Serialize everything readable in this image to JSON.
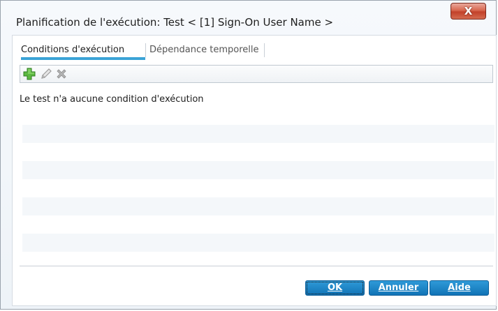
{
  "window": {
    "title": "Planification de l'exécution: Test < [1] Sign-On User Name >",
    "close_glyph": "X"
  },
  "tabs": [
    {
      "label": "Conditions d'exécution",
      "active": true
    },
    {
      "label": "Dépendance temporelle",
      "active": false
    }
  ],
  "toolbar": {
    "add_icon": "add-icon",
    "edit_icon": "pencil-icon",
    "delete_icon": "delete-icon",
    "colors": {
      "add": "#4caf38",
      "disabled": "#9b9b9b"
    }
  },
  "content": {
    "empty_message": "Le test n'a aucune condition d'exécution"
  },
  "buttons": {
    "ok_label": "OK",
    "cancel_label": "Annuler",
    "help_label": "Aide"
  },
  "colors": {
    "accent": "#3ba3d6",
    "button": "#1a7fc4",
    "close": "#c7432c"
  }
}
